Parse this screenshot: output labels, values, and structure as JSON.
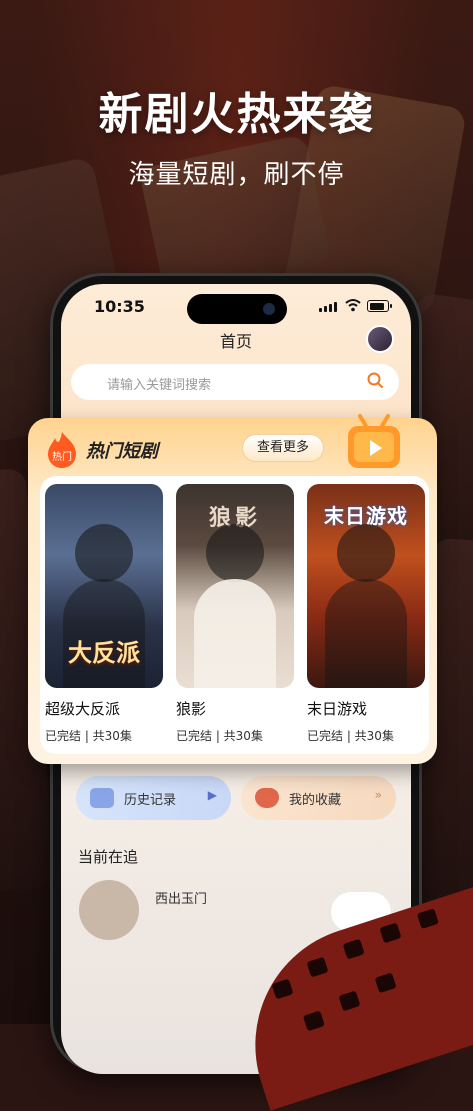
{
  "promo": {
    "headline": "新剧火热来袭",
    "subline": "海量短剧，刷不停"
  },
  "status_bar": {
    "time": "10:35"
  },
  "nav": {
    "title": "首页"
  },
  "search": {
    "placeholder": "请输入关键词搜索"
  },
  "hot_section": {
    "badge": "热门",
    "title": "热门短剧",
    "more_label": "查看更多",
    "dramas": [
      {
        "title": "超级大反派",
        "poster_text": "大反派",
        "status": "已完结 | 共30集"
      },
      {
        "title": "狼影",
        "poster_text": "狼影",
        "status": "已完结 | 共30集"
      },
      {
        "title": "末日游戏",
        "poster_text": "末日游戏",
        "status": "已完结 | 共30集"
      }
    ]
  },
  "quick_links": {
    "history": "历史记录",
    "favorites": "我的收藏"
  },
  "now_watching": {
    "title": "当前在追",
    "item_title": "西出玉门"
  },
  "colors": {
    "accent": "#ff7a2e",
    "hot_badge": "#ff5a1f",
    "bg": "#2a1512"
  }
}
